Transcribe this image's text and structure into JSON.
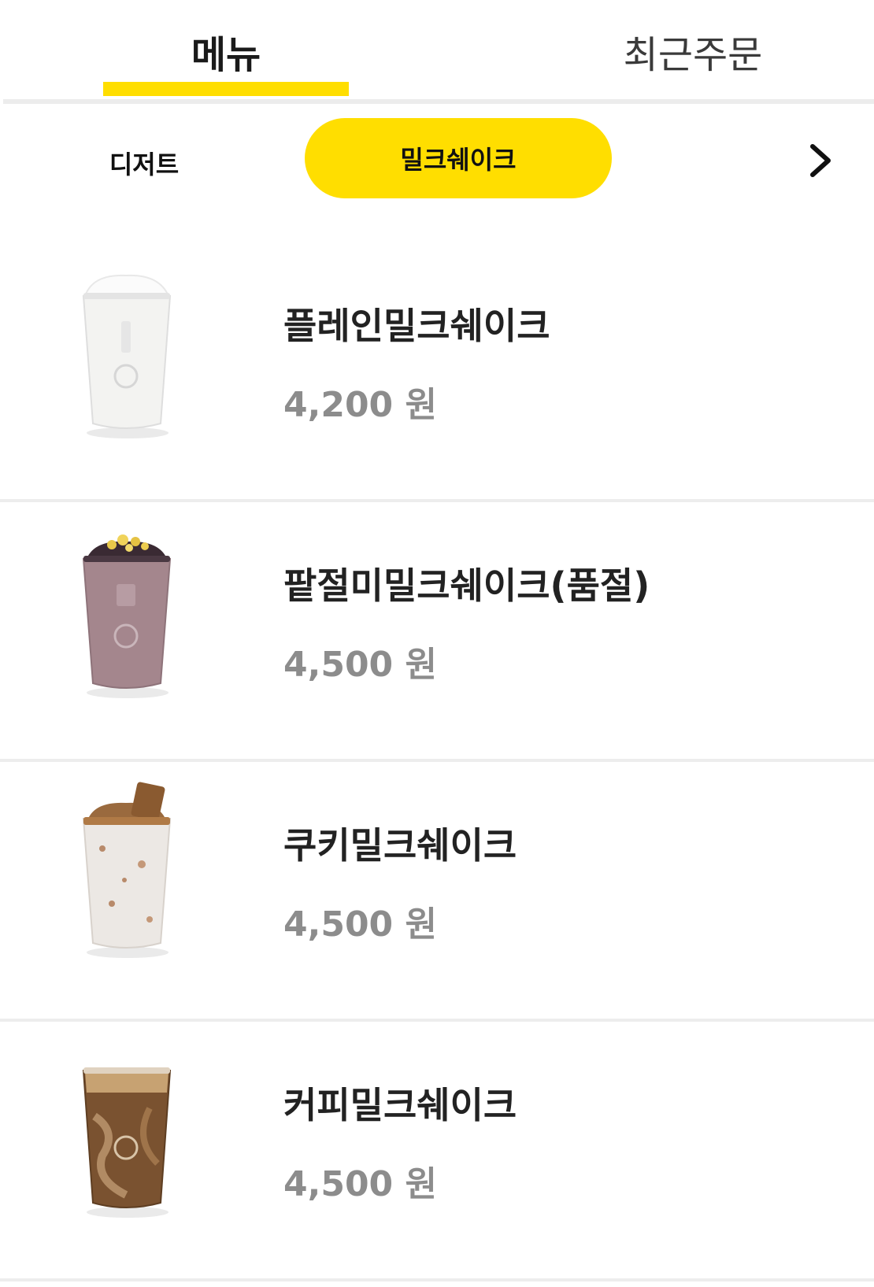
{
  "tabs": {
    "menu": "메뉴",
    "recent": "최근주문"
  },
  "categories": {
    "dessert": "디저트",
    "active": "밀크쉐이크"
  },
  "colors": {
    "accent": "#ffde00",
    "price": "#8c8c8c",
    "divider": "#ededed"
  },
  "menu_items": [
    {
      "name": "플레인밀크쉐이크",
      "price": "4,200 원",
      "drink": "plain"
    },
    {
      "name": "팥절미밀크쉐이크(품절)",
      "price": "4,500 원",
      "drink": "redbean"
    },
    {
      "name": "쿠키밀크쉐이크",
      "price": "4,500 원",
      "drink": "cookie"
    },
    {
      "name": "커피밀크쉐이크",
      "price": "4,500 원",
      "drink": "coffee"
    }
  ]
}
